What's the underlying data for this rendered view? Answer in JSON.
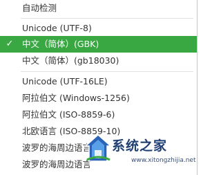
{
  "menu": {
    "items": [
      {
        "label": "自动检测"
      },
      {
        "label": "Unicode (UTF-8)"
      },
      {
        "label": "中文（简体）(GBK)",
        "selected": true
      },
      {
        "label": "中文（简体）(gb18030)"
      },
      {
        "label": "Unicode (UTF-16LE)"
      },
      {
        "label": "阿拉伯文 (Windows-1256)"
      },
      {
        "label": "阿拉伯文 (ISO-8859-6)"
      },
      {
        "label": "北欧语言 (ISO-8859-10)"
      },
      {
        "label": "波罗的海周边语言"
      },
      {
        "label": "波罗的海周边语言"
      }
    ],
    "check_glyph": "✓",
    "selected_color": "#3aa842"
  },
  "watermark": {
    "text": "系统之家",
    "url": "www.xitongzhijia.net",
    "logo_icon": "house-logo-icon"
  }
}
